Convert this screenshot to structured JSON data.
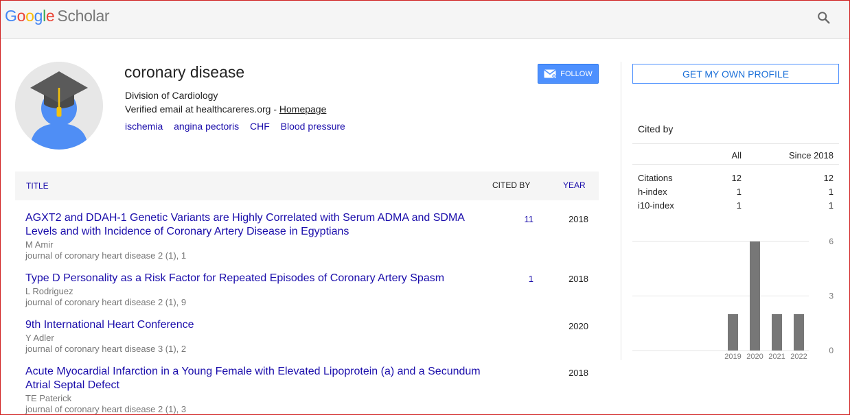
{
  "header": {
    "logo": [
      "G",
      "o",
      "o",
      "g",
      "l",
      "e"
    ],
    "logo_suffix": "Scholar",
    "search_icon": "search-icon"
  },
  "profile": {
    "name": "coronary disease",
    "affiliation": "Division of Cardiology",
    "email_text": "Verified email at healthcareres.org - ",
    "homepage_label": "Homepage",
    "interests": [
      "ischemia",
      "angina pectoris",
      "CHF",
      "Blood pressure"
    ],
    "follow_label": "FOLLOW",
    "avatar_icon": "graduate-cap-avatar-icon"
  },
  "table": {
    "col_title": "TITLE",
    "col_cited": "CITED BY",
    "col_year": "YEAR",
    "rows": [
      {
        "title": "AGXT2 and DDAH-1 Genetic Variants are Highly Correlated with Serum ADMA and SDMA Levels and with Incidence of Coronary Artery Disease in Egyptians",
        "authors": "M Amir",
        "journal": "journal of coronary heart disease 2 (1), 1",
        "cited": "11",
        "year": "2018"
      },
      {
        "title": "Type D Personality as a Risk Factor for Repeated Episodes of Coronary Artery Spasm",
        "authors": "L Rodriguez",
        "journal": "journal of coronary heart disease 2 (1), 9",
        "cited": "1",
        "year": "2018"
      },
      {
        "title": "9th International Heart Conference",
        "authors": "Y Adler",
        "journal": "journal of coronary heart disease 3 (1), 2",
        "cited": "",
        "year": "2020"
      },
      {
        "title": "Acute Myocardial Infarction in a Young Female with Elevated Lipoprotein (a) and a Secundum Atrial Septal Defect",
        "authors": "TE Paterick",
        "journal": "journal of coronary heart disease 2 (1), 3",
        "cited": "",
        "year": "2018"
      }
    ]
  },
  "sidebar": {
    "get_profile_label": "GET MY OWN PROFILE",
    "cited_by_label": "Cited by",
    "col_all": "All",
    "col_since": "Since 2018",
    "stats": [
      {
        "label": "Citations",
        "all": "12",
        "since": "12"
      },
      {
        "label": "h-index",
        "all": "1",
        "since": "1"
      },
      {
        "label": "i10-index",
        "all": "1",
        "since": "1"
      }
    ]
  },
  "chart_data": {
    "type": "bar",
    "categories": [
      "2019",
      "2020",
      "2021",
      "2022"
    ],
    "values": [
      2,
      6,
      2,
      2
    ],
    "yticks": [
      "0",
      "3",
      "6"
    ],
    "ylim": [
      0,
      6
    ],
    "bar_color": "#777777",
    "grid": true
  },
  "colors": {
    "link": "#1a0dab",
    "follow_button": "#4d90fe",
    "frame": "#d01f1f"
  }
}
